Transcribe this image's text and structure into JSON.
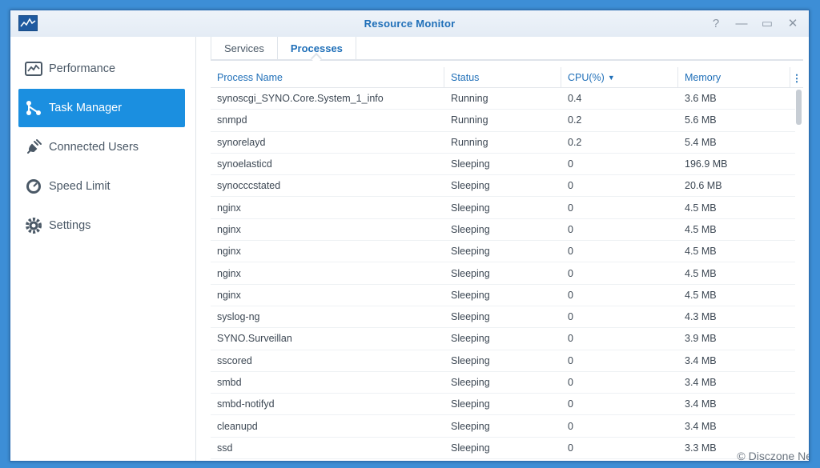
{
  "window": {
    "title": "Resource Monitor"
  },
  "sidebar": {
    "items": [
      {
        "label": "Performance",
        "icon": "performance-icon",
        "active": false
      },
      {
        "label": "Task Manager",
        "icon": "task-manager-icon",
        "active": true
      },
      {
        "label": "Connected Users",
        "icon": "plug-icon",
        "active": false
      },
      {
        "label": "Speed Limit",
        "icon": "speedometer-icon",
        "active": false
      },
      {
        "label": "Settings",
        "icon": "gear-icon",
        "active": false
      }
    ]
  },
  "tabs": [
    {
      "label": "Services",
      "active": false
    },
    {
      "label": "Processes",
      "active": true
    }
  ],
  "table": {
    "columns": [
      "Process Name",
      "Status",
      "CPU(%)",
      "Memory"
    ],
    "sort": {
      "column": "CPU(%)",
      "direction": "descending"
    },
    "rows": [
      [
        "synoscgi_SYNO.Core.System_1_info",
        "Running",
        "0.4",
        "3.6 MB"
      ],
      [
        "snmpd",
        "Running",
        "0.2",
        "5.6 MB"
      ],
      [
        "synorelayd",
        "Running",
        "0.2",
        "5.4 MB"
      ],
      [
        "synoelasticd",
        "Sleeping",
        "0",
        "196.9 MB"
      ],
      [
        "synocccstated",
        "Sleeping",
        "0",
        "20.6 MB"
      ],
      [
        "nginx",
        "Sleeping",
        "0",
        "4.5 MB"
      ],
      [
        "nginx",
        "Sleeping",
        "0",
        "4.5 MB"
      ],
      [
        "nginx",
        "Sleeping",
        "0",
        "4.5 MB"
      ],
      [
        "nginx",
        "Sleeping",
        "0",
        "4.5 MB"
      ],
      [
        "nginx",
        "Sleeping",
        "0",
        "4.5 MB"
      ],
      [
        "syslog-ng",
        "Sleeping",
        "0",
        "4.3 MB"
      ],
      [
        "SYNO.Surveillan",
        "Sleeping",
        "0",
        "3.9 MB"
      ],
      [
        "sscored",
        "Sleeping",
        "0",
        "3.4 MB"
      ],
      [
        "smbd",
        "Sleeping",
        "0",
        "3.4 MB"
      ],
      [
        "smbd-notifyd",
        "Sleeping",
        "0",
        "3.4 MB"
      ],
      [
        "cleanupd",
        "Sleeping",
        "0",
        "3.4 MB"
      ],
      [
        "ssd",
        "Sleeping",
        "0",
        "3.3 MB"
      ]
    ]
  },
  "watermark": "© Disczone Ne",
  "colors": {
    "accent": "#1f6fb8",
    "active_nav": "#1b8fe0",
    "desktop": "#3d8ed6"
  }
}
